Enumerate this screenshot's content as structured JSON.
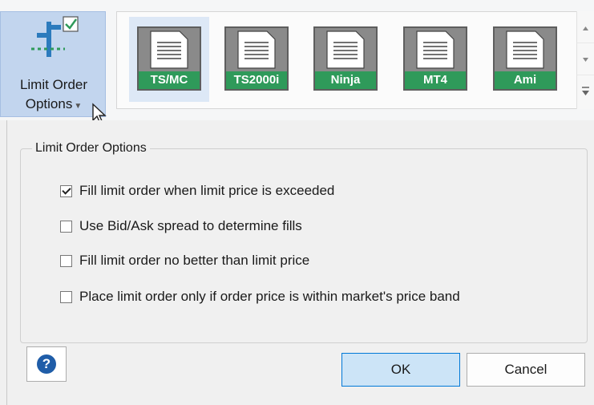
{
  "toolbar": {
    "limit_order_button": {
      "line1": "Limit Order",
      "line2": "Options",
      "icon": "limit-order-icon"
    },
    "gallery": {
      "items": [
        {
          "label": "TS/MC",
          "selected": true
        },
        {
          "label": "TS2000i",
          "selected": false
        },
        {
          "label": "Ninja",
          "selected": false
        },
        {
          "label": "MT4",
          "selected": false
        },
        {
          "label": "Ami",
          "selected": false
        }
      ],
      "label_color": "#2f9a5a"
    }
  },
  "dialog": {
    "group_title": "Limit Order Options",
    "options": [
      {
        "label": "Fill limit order when limit price is exceeded",
        "checked": true
      },
      {
        "label": "Use Bid/Ask spread to determine fills",
        "checked": false
      },
      {
        "label": "Fill limit order no better than limit price",
        "checked": false
      },
      {
        "label": "Place limit order only if order price is within market's price band",
        "checked": false
      }
    ],
    "help_label": "?",
    "ok_label": "OK",
    "cancel_label": "Cancel"
  }
}
